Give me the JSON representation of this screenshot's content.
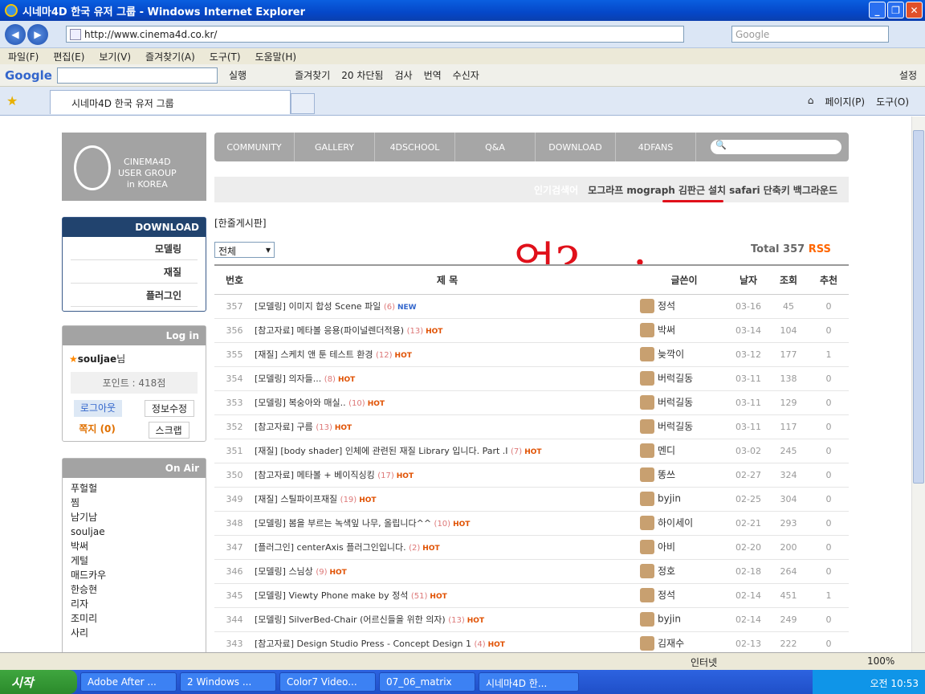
{
  "window": {
    "title": "시네마4D 한국 유저 그룹 - Windows Internet Explorer"
  },
  "address": {
    "url": "http://www.cinema4d.co.kr/",
    "search_placeholder": "Google"
  },
  "menu": [
    "파일(F)",
    "편집(E)",
    "보기(V)",
    "즐겨찾기(A)",
    "도구(T)",
    "도움말(H)"
  ],
  "gtoolbar": {
    "logo": "Google",
    "run": "실행",
    "fav": "즐겨찾기",
    "blocked": "20 차단됨",
    "check": "검사",
    "translate": "번역",
    "recv": "수신자",
    "settings": "설정"
  },
  "tab": {
    "title": "시네마4D 한국 유저 그룹"
  },
  "cmdbar": {
    "page": "페이지(P)",
    "tools": "도구(O)"
  },
  "site": {
    "logo": [
      "CINEMA4D",
      "USER GROUP",
      "in KOREA"
    ],
    "nav": [
      "COMMUNITY",
      "GALLERY",
      "4DSCHOOL",
      "Q&A",
      "DOWNLOAD",
      "4DFANS"
    ],
    "popular_label": "인기검색어",
    "popular": [
      "모그라프",
      "mograph",
      "김판근",
      "설치",
      "safari",
      "단축키",
      "백그라운드"
    ],
    "download": {
      "title": "DOWNLOAD",
      "items": [
        "모델링",
        "재질",
        "플러그인"
      ]
    },
    "login": {
      "title": "Log in",
      "user": "souljae",
      "suffix": "님",
      "points": "포인트 : 418점",
      "logout": "로그아웃",
      "edit": "정보수정",
      "note": "쪽지 (0)",
      "scrap": "스크랩"
    },
    "onair": {
      "title": "On Air",
      "users": [
        "푸헐헐",
        "찜",
        "남기남",
        "souljae",
        "박써",
        "게털",
        "매드카우",
        "한승현",
        "리자",
        "조미리",
        "사리"
      ]
    },
    "board_title": "[한줄게시판]",
    "filter": "전체",
    "total": "Total 357",
    "rss": "RSS",
    "headers": [
      "번호",
      "제 목",
      "글쓴이",
      "날자",
      "조회",
      "추천"
    ],
    "rows": [
      [
        "357",
        "[모델링] 이미지 합성 Scene 파일",
        "(6)",
        "NEW",
        "정석",
        "03-16",
        "45",
        "0"
      ],
      [
        "356",
        "[참고자료] 메타볼 응용(파이널렌더적용)",
        "(13)",
        "HOT",
        "박써",
        "03-14",
        "104",
        "0"
      ],
      [
        "355",
        "[재질] 스케치 앤 툰 테스트 환경",
        "(12)",
        "HOT",
        "늦깍이",
        "03-12",
        "177",
        "1"
      ],
      [
        "354",
        "[모델링] 의자들...",
        "(8)",
        "HOT",
        "버럭길동",
        "03-11",
        "138",
        "0"
      ],
      [
        "353",
        "[모델링] 복숭아와 매실..",
        "(10)",
        "HOT",
        "버럭길동",
        "03-11",
        "129",
        "0"
      ],
      [
        "352",
        "[참고자료] 구름",
        "(13)",
        "HOT",
        "버럭길동",
        "03-11",
        "117",
        "0"
      ],
      [
        "351",
        "[재질] [body shader] 인체에 관련된 재질 Library 입니다. Part .I",
        "(7)",
        "HOT",
        "멘디",
        "03-02",
        "245",
        "0"
      ],
      [
        "350",
        "[참고자료] 메타볼 + 베이직싱킹",
        "(17)",
        "HOT",
        "똥쓰",
        "02-27",
        "324",
        "0"
      ],
      [
        "349",
        "[재질] 스틸파이프재질",
        "(19)",
        "HOT",
        "byjin",
        "02-25",
        "304",
        "0"
      ],
      [
        "348",
        "[모델링] 봄을 부르는 녹색잎 나무, 올립니다^^",
        "(10)",
        "HOT",
        "하이세이",
        "02-21",
        "293",
        "0"
      ],
      [
        "347",
        "[플러그인] centerAxis 플러그인입니다.",
        "(2)",
        "HOT",
        "아비",
        "02-20",
        "200",
        "0"
      ],
      [
        "346",
        "[모델링] 스님상",
        "(9)",
        "HOT",
        "정호",
        "02-18",
        "264",
        "0"
      ],
      [
        "345",
        "[모델링] Viewty Phone make by 정석",
        "(51)",
        "HOT",
        "정석",
        "02-14",
        "451",
        "1"
      ],
      [
        "344",
        "[모델링] SilverBed-Chair (어르신들을 위한 의자)",
        "(13)",
        "HOT",
        "byjin",
        "02-14",
        "249",
        "0"
      ],
      [
        "343",
        "[참고자료] Design Studio Press - Concept Design 1",
        "(4)",
        "HOT",
        "김재수",
        "02-13",
        "222",
        "0"
      ]
    ]
  },
  "scribble": "엉?-_-;",
  "status": {
    "zone": "인터넷",
    "zoom": "100%"
  },
  "taskbar": {
    "start": "시작",
    "items": [
      "Adobe After ...",
      "2 Windows ...",
      "Color7 Video...",
      "07_06_matrix",
      "시네마4D 한..."
    ],
    "clock": "오전 10:53"
  }
}
